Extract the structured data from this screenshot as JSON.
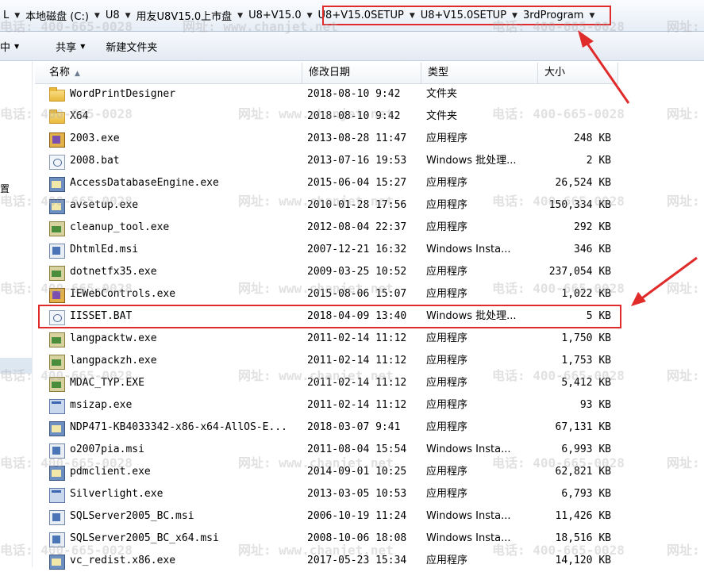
{
  "address_bar": {
    "crumbs": [
      {
        "label": "L",
        "chevron": true
      },
      {
        "label": "本地磁盘 (C:)",
        "chevron": true
      },
      {
        "label": "U8",
        "chevron": true
      },
      {
        "label": "用友U8V15.0上市盘",
        "chevron": true
      },
      {
        "label": "U8+V15.0",
        "chevron": true
      },
      {
        "label": "U8+V15.0SETUP",
        "chevron": true
      },
      {
        "label": "U8+V15.0SETUP",
        "chevron": true
      },
      {
        "label": "3rdProgram",
        "chevron": true
      }
    ]
  },
  "toolbar": {
    "left_fragment": "中",
    "share_label": "共享",
    "new_folder_label": "新建文件夹"
  },
  "nav_fragment": "置",
  "columns": {
    "name": "名称",
    "date": "修改日期",
    "type": "类型",
    "size": "大小"
  },
  "files": [
    {
      "name": "WordPrintDesigner",
      "date": "2018-08-10 9:42",
      "type": "文件夹",
      "size": "",
      "icon": "folder-icon"
    },
    {
      "name": "X64",
      "date": "2018-08-10 9:42",
      "type": "文件夹",
      "size": "",
      "icon": "folder-icon"
    },
    {
      "name": "2003.exe",
      "date": "2013-08-28 11:47",
      "type": "应用程序",
      "size": "248 KB",
      "icon": "app-icon"
    },
    {
      "name": "2008.bat",
      "date": "2013-07-16 19:53",
      "type": "Windows 批处理...",
      "size": "2 KB",
      "icon": "batch-file-icon"
    },
    {
      "name": "AccessDatabaseEngine.exe",
      "date": "2015-06-04 15:27",
      "type": "应用程序",
      "size": "26,524 KB",
      "icon": "installer-icon"
    },
    {
      "name": "avsetup.exe",
      "date": "2010-01-28 17:56",
      "type": "应用程序",
      "size": "150,334 KB",
      "icon": "installer-icon"
    },
    {
      "name": "cleanup_tool.exe",
      "date": "2012-08-04 22:37",
      "type": "应用程序",
      "size": "292 KB",
      "icon": "setup-icon"
    },
    {
      "name": "DhtmlEd.msi",
      "date": "2007-12-21 16:32",
      "type": "Windows Insta...",
      "size": "346 KB",
      "icon": "msi-icon"
    },
    {
      "name": "dotnetfx35.exe",
      "date": "2009-03-25 10:52",
      "type": "应用程序",
      "size": "237,054 KB",
      "icon": "setup-icon"
    },
    {
      "name": "IEWebControls.exe",
      "date": "2015-08-06 15:07",
      "type": "应用程序",
      "size": "1,022 KB",
      "icon": "app-icon"
    },
    {
      "name": "IISSET.BAT",
      "date": "2018-04-09 13:40",
      "type": "Windows 批处理...",
      "size": "5 KB",
      "icon": "batch-file-icon"
    },
    {
      "name": "langpacktw.exe",
      "date": "2011-02-14 11:12",
      "type": "应用程序",
      "size": "1,750 KB",
      "icon": "setup-icon"
    },
    {
      "name": "langpackzh.exe",
      "date": "2011-02-14 11:12",
      "type": "应用程序",
      "size": "1,753 KB",
      "icon": "setup-icon"
    },
    {
      "name": "MDAC_TYP.EXE",
      "date": "2011-02-14 11:12",
      "type": "应用程序",
      "size": "5,412 KB",
      "icon": "setup-icon"
    },
    {
      "name": "msizap.exe",
      "date": "2011-02-14 11:12",
      "type": "应用程序",
      "size": "93 KB",
      "icon": "window-app-icon"
    },
    {
      "name": "NDP471-KB4033342-x86-x64-AllOS-E...",
      "date": "2018-03-07 9:41",
      "type": "应用程序",
      "size": "67,131 KB",
      "icon": "installer-icon"
    },
    {
      "name": "o2007pia.msi",
      "date": "2011-08-04 15:54",
      "type": "Windows Insta...",
      "size": "6,993 KB",
      "icon": "msi-icon"
    },
    {
      "name": "pdmclient.exe",
      "date": "2014-09-01 10:25",
      "type": "应用程序",
      "size": "62,821 KB",
      "icon": "installer-icon"
    },
    {
      "name": "Silverlight.exe",
      "date": "2013-03-05 10:53",
      "type": "应用程序",
      "size": "6,793 KB",
      "icon": "window-app-icon"
    },
    {
      "name": "SQLServer2005_BC.msi",
      "date": "2006-10-19 11:24",
      "type": "Windows Insta...",
      "size": "11,426 KB",
      "icon": "msi-icon"
    },
    {
      "name": "SQLServer2005_BC_x64.msi",
      "date": "2008-10-06 18:08",
      "type": "Windows Insta...",
      "size": "18,516 KB",
      "icon": "msi-icon"
    },
    {
      "name": "vc_redist.x86.exe",
      "date": "2017-05-23 15:34",
      "type": "应用程序",
      "size": "14,120 KB",
      "icon": "installer-icon"
    }
  ],
  "watermark": {
    "phone": "电话: 400-665-0028",
    "site": "网址: www.chanjet.net"
  },
  "colors": {
    "annotation": "#e02b2b",
    "header_bg": "#f1f4f8",
    "address_bg": "#e6edf6"
  }
}
